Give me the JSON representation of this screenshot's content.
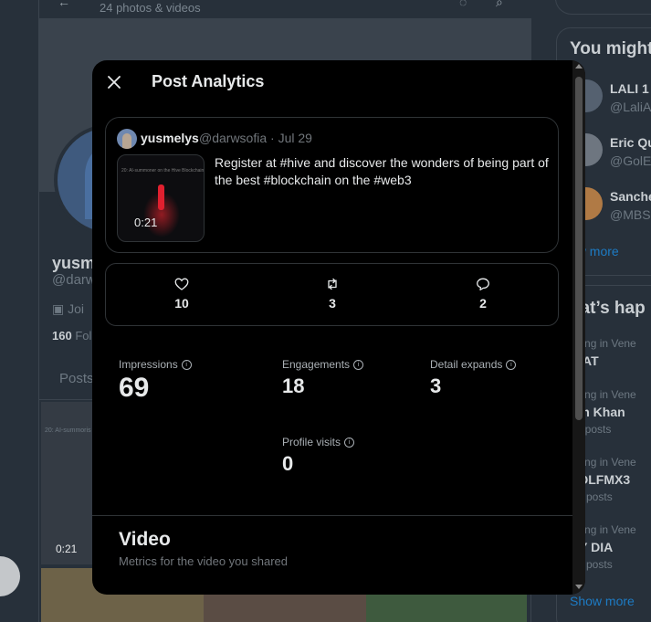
{
  "background": {
    "header_subtitle": "24 photos & videos",
    "profile": {
      "name": "yusm",
      "handle": "@darw",
      "joined": "Joi",
      "following_count": "160",
      "following_label": "Fol"
    },
    "tab_posts": "Posts",
    "media_video_title": "20: AI-summoris",
    "media_video_duration": "0:21",
    "who_to_follow": {
      "heading": "You might",
      "users": [
        {
          "name": "LALI 1 K",
          "handle": "@LaliAc"
        },
        {
          "name": "Eric Qu",
          "handle": "@GolEr"
        },
        {
          "name": "Sanche",
          "handle": "@MBS1"
        }
      ],
      "show_more": "ow more"
    },
    "trends": {
      "heading": "hat’s hap",
      "items": [
        {
          "context": "nding in Vene",
          "title": "NIAT",
          "posts": ""
        },
        {
          "context": "nding in Vene",
          "title": "rim Khan",
          "posts": "45 posts"
        },
        {
          "context": "nding in Vene",
          "title": "CDLFMX3",
          "posts": "9K posts"
        },
        {
          "context": "nding in Vene",
          "title": "DY DIA",
          "posts": "1K posts"
        }
      ],
      "show_more": "Show more"
    }
  },
  "modal": {
    "title": "Post Analytics",
    "post": {
      "author_name": "yusmelys",
      "author_meta": "@darwsofia · Jul 29",
      "thumb_title": "20: AI-summoner on the Hive Blockchain",
      "video_duration": "0:21",
      "text": "Register at #hive and discover the wonders of being part of the best #blockchain on the #web3"
    },
    "engagement_stats": {
      "likes": "10",
      "reposts": "3",
      "replies": "2"
    },
    "metrics": {
      "impressions": {
        "label": "Impressions",
        "value": "69"
      },
      "engagements": {
        "label": "Engagements",
        "value": "18"
      },
      "detail_expands": {
        "label": "Detail expands",
        "value": "3"
      },
      "profile_visits": {
        "label": "Profile visits",
        "value": "0"
      }
    },
    "video_section": {
      "title": "Video",
      "subtitle": "Metrics for the video you shared"
    }
  },
  "colors": {
    "modal_bg": "#000000",
    "backdrop": "#27303a",
    "border": "#2f3336",
    "link_blue": "#1d9bf0"
  }
}
